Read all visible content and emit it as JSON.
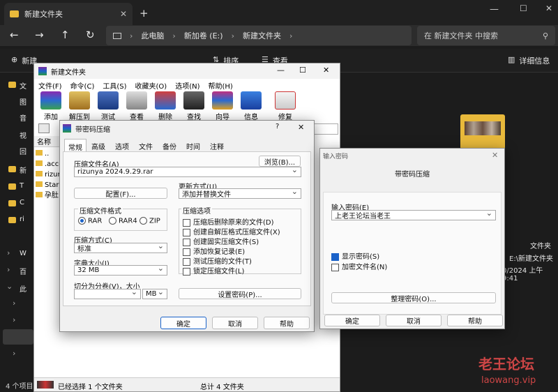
{
  "explorer": {
    "tab_title": "新建文件夹",
    "breadcrumb": [
      "此电脑",
      "新加卷 (E:)",
      "新建文件夹"
    ],
    "search_placeholder": "在 新建文件夹 中搜索",
    "cmd": {
      "new": "新建",
      "sort": "排序",
      "view": "查看",
      "details": "详细信息"
    },
    "nav_items": [
      "文",
      "图",
      "音",
      "视",
      "回",
      "新",
      "T",
      "C",
      "ri",
      "W",
      "百",
      "此"
    ],
    "col_size": "大小",
    "right_info": [
      "文件夹",
      "E:\\新建文件夹",
      "0/2024 上午9:41"
    ],
    "status_items": "4 个项目",
    "status_selected": "已经选择 1 个文件夹",
    "status_total": "总计 4 文件夹"
  },
  "winrar": {
    "title": "新建文件夹",
    "menu": [
      "文件(F)",
      "命令(C)",
      "工具(S)",
      "收藏夹(O)",
      "选项(N)",
      "帮助(H)"
    ],
    "toolbar": [
      "添加",
      "解压到",
      "测试",
      "查看",
      "删除",
      "查找",
      "向导",
      "信息",
      "修复"
    ],
    "col_name": "名称",
    "files": [
      "..",
      ".acce",
      "rizun",
      "Star",
      "孕肚"
    ]
  },
  "archive_dialog": {
    "title": "带密码压缩",
    "tabs": [
      "常规",
      "高级",
      "选项",
      "文件",
      "备份",
      "时间",
      "注释"
    ],
    "name_label": "压缩文件名(A)",
    "browse": "浏览(B)...",
    "name_value": "rizunya 2024.9.29.rar",
    "profiles": "配置(F)...",
    "update_label": "更新方式(U)",
    "update_value": "添加并替换文件",
    "format_label": "压缩文件格式",
    "formats": [
      "RAR",
      "RAR4",
      "ZIP"
    ],
    "options_label": "压缩选项",
    "options": [
      "压缩后删除原来的文件(D)",
      "创建自解压格式压缩文件(X)",
      "创建固实压缩文件(S)",
      "添加恢复记录(E)",
      "测试压缩的文件(T)",
      "锁定压缩文件(L)"
    ],
    "method_label": "压缩方式(C)",
    "method_value": "标准",
    "dict_label": "字典大小(I)",
    "dict_value": "32 MB",
    "split_label": "切分为分卷(V)，大小",
    "split_unit": "MB",
    "set_password": "设置密码(P)...",
    "ok": "确定",
    "cancel": "取消",
    "help": "帮助"
  },
  "password_dialog": {
    "title": "输入密码",
    "heading": "带密码压缩",
    "label": "输入密码(E)",
    "value": "上老王论坛当老王",
    "show_password": "显示密码(S)",
    "encrypt_names": "加密文件名(N)",
    "organize": "整理密码(O)...",
    "ok": "确定",
    "cancel": "取消",
    "help": "帮助"
  },
  "watermark": {
    "line1": "老王论坛",
    "line2": "laowang.vip"
  },
  "colors": {
    "accent": "#1a62c9",
    "folder": "#e8b93b",
    "watermark": "#e04a4a"
  }
}
